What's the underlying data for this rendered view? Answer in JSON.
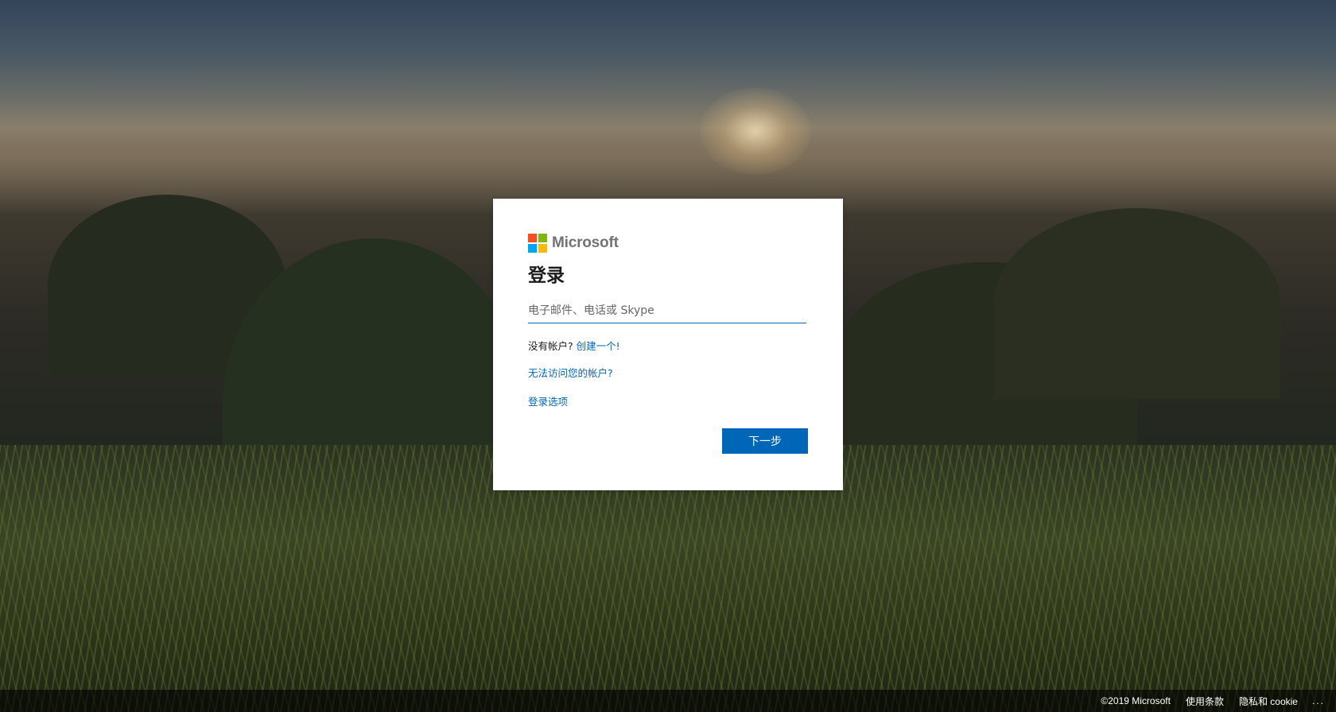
{
  "brand": {
    "name": "Microsoft",
    "colors": {
      "red": "#f25022",
      "green": "#7fba00",
      "blue": "#00a4ef",
      "yellow": "#ffb900",
      "accent": "#0067b8"
    }
  },
  "signin": {
    "title": "登录",
    "email_placeholder": "电子邮件、电话或 Skype",
    "email_value": "",
    "no_account_text": "没有帐户?",
    "create_link": "创建一个!",
    "cant_access_link": "无法访问您的帐户?",
    "options_link": "登录选项",
    "next_button": "下一步"
  },
  "footer": {
    "copyright": "©2019 Microsoft",
    "terms": "使用条款",
    "privacy": "隐私和 cookie",
    "more": "..."
  }
}
